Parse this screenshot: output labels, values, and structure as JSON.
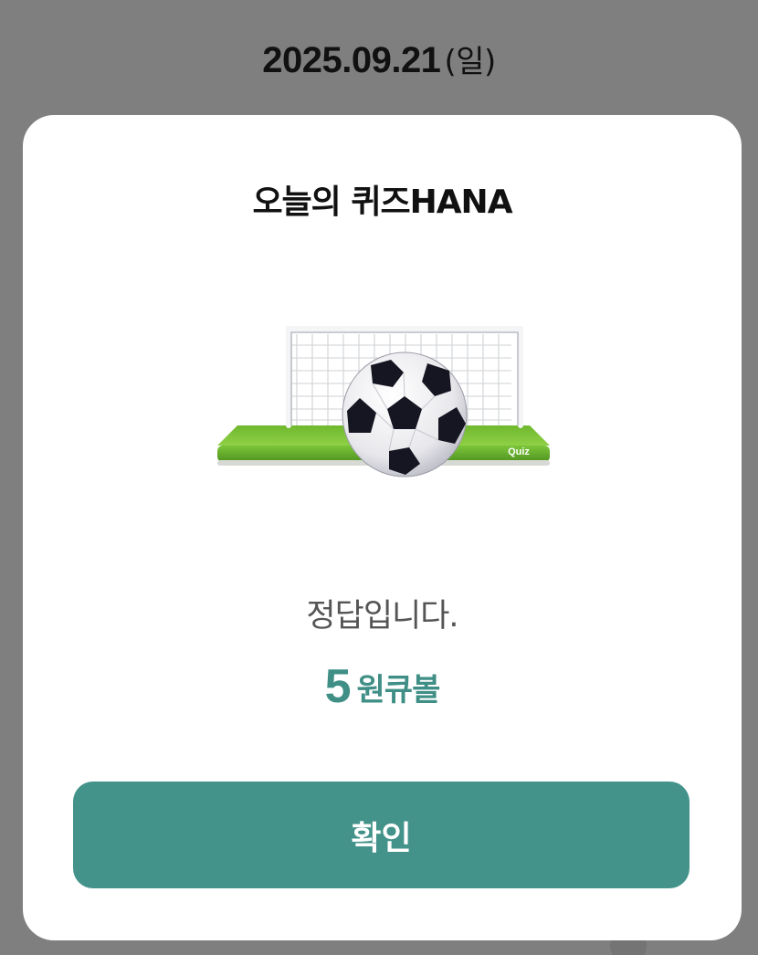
{
  "background": {
    "date": "2025.09.21",
    "day_of_week": "(일)"
  },
  "modal": {
    "title": "오늘의 퀴즈HANA",
    "illustration": {
      "icon": "soccer-ball-goal-illustration",
      "badge_text": "Quiz"
    },
    "result_text": "정답입니다.",
    "reward_amount": "5",
    "reward_unit": "원큐볼",
    "confirm_label": "확인"
  },
  "colors": {
    "accent": "#43938a",
    "overlay": "#7f7f7f",
    "grass": "#7cc23a"
  }
}
